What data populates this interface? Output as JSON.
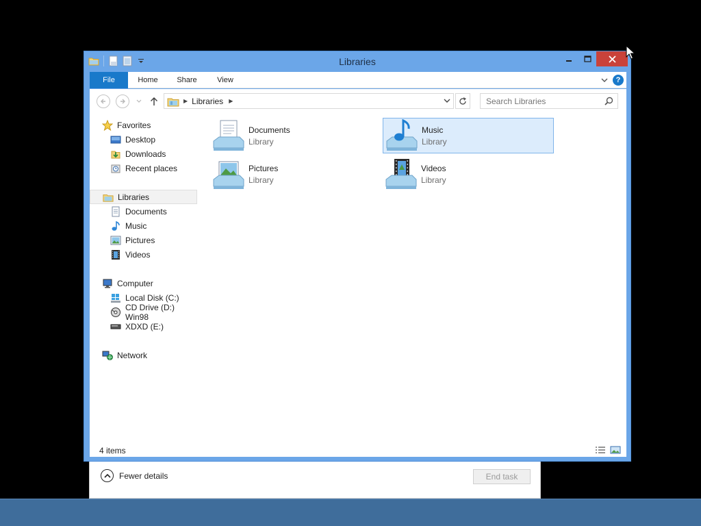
{
  "window": {
    "title": "Libraries"
  },
  "ribbon": {
    "file": "File",
    "home": "Home",
    "share": "Share",
    "view": "View",
    "help": "?"
  },
  "address": {
    "crumb": "Libraries"
  },
  "search": {
    "placeholder": "Search Libraries"
  },
  "nav": {
    "favorites": "Favorites",
    "desktop": "Desktop",
    "downloads": "Downloads",
    "recent": "Recent places",
    "libraries": "Libraries",
    "documents": "Documents",
    "music": "Music",
    "pictures": "Pictures",
    "videos": "Videos",
    "computer": "Computer",
    "local_disk": "Local Disk (C:)",
    "cd_drive": "CD Drive (D:) Win98",
    "xdxd": "XDXD (E:)",
    "network": "Network"
  },
  "items": [
    {
      "name": "Documents",
      "kind": "Library"
    },
    {
      "name": "Music",
      "kind": "Library"
    },
    {
      "name": "Pictures",
      "kind": "Library"
    },
    {
      "name": "Videos",
      "kind": "Library"
    }
  ],
  "status": {
    "count": "4 items"
  },
  "task_dialog": {
    "fewer_details": "Fewer details",
    "end_task": "End task"
  },
  "colors": {
    "window_frame": "#6ba6e8",
    "file_tab": "#1979ca",
    "close_button": "#c9423a",
    "selection": "#dcecfc",
    "taskbar": "#3f6d9b"
  },
  "icons": {
    "qat": [
      "properties-icon",
      "new-folder-icon",
      "customize-qat-icon"
    ],
    "window_controls": [
      "minimize-icon",
      "maximize-icon",
      "close-icon"
    ],
    "nav": [
      "back-icon",
      "forward-icon",
      "recent-dropdown-icon",
      "up-icon",
      "refresh-icon",
      "search-icon"
    ]
  }
}
